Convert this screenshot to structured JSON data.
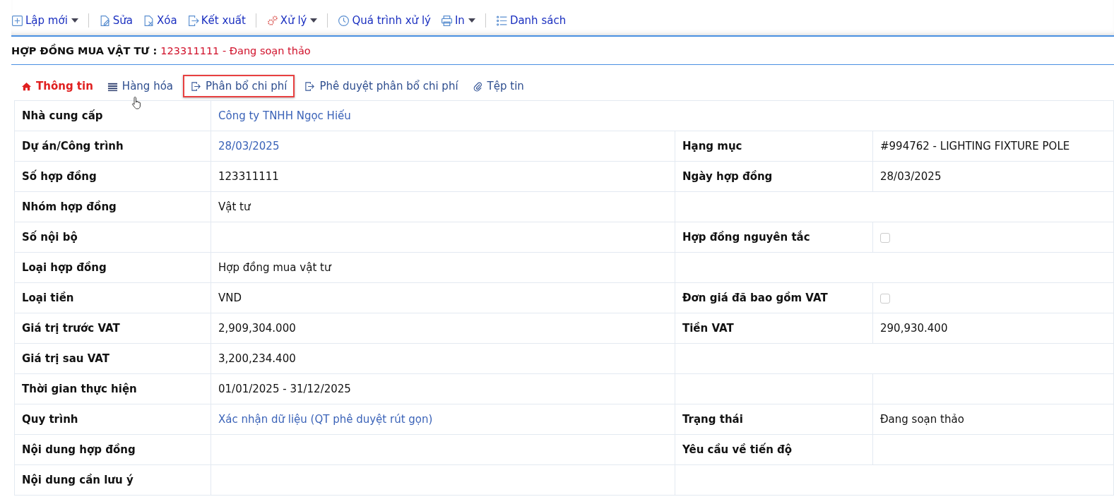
{
  "toolbar_groups": [
    [
      {
        "kind": "plus",
        "label": "Lập mới",
        "dropdown": true
      }
    ],
    [
      {
        "kind": "edit",
        "label": "Sửa",
        "dropdown": false
      },
      {
        "kind": "delete",
        "label": "Xóa",
        "dropdown": false
      },
      {
        "kind": "export",
        "label": "Kết xuất",
        "dropdown": false
      }
    ],
    [
      {
        "kind": "gears",
        "label": "Xử lý",
        "dropdown": true
      }
    ],
    [
      {
        "kind": "clock",
        "label": "Quá trình xử lý",
        "dropdown": false
      },
      {
        "kind": "print",
        "label": "In",
        "dropdown": true
      }
    ],
    [
      {
        "kind": "list",
        "label": "Danh sách",
        "dropdown": false
      }
    ]
  ],
  "header": {
    "title": "HỢP ĐỒNG MUA VẬT TƯ :",
    "status": "123311111 - Đang soạn thảo"
  },
  "tabs": [
    {
      "kind": "home",
      "label": "Thông tin",
      "selected": true,
      "highlighted": false
    },
    {
      "kind": "lines",
      "label": "Hàng hóa",
      "selected": false,
      "highlighted": false
    },
    {
      "kind": "export",
      "label": "Phân bổ chi phí",
      "selected": false,
      "highlighted": true
    },
    {
      "kind": "export",
      "label": "Phê duyệt phân bổ chi phí",
      "selected": false,
      "highlighted": false
    },
    {
      "kind": "clip",
      "label": "Tệp tin",
      "selected": false,
      "highlighted": false
    }
  ],
  "rows": [
    {
      "label": "Nhà cung cấp",
      "value": "Công ty TNHH Ngọc Hiếu",
      "link": true
    },
    {
      "label": "Dự án/Công trình",
      "value": "28/03/2025",
      "link": true,
      "right": {
        "kind": "text",
        "label": "Hạng mục",
        "value": "#994762 - LIGHTING FIXTURE POLE"
      }
    },
    {
      "label": "Số hợp đồng",
      "value": "123311111",
      "link": false,
      "right": {
        "kind": "text",
        "label": "Ngày hợp đồng",
        "value": "28/03/2025"
      }
    },
    {
      "label": "Nhóm hợp đồng",
      "value": "Vật tư",
      "link": false,
      "right": {
        "kind": "blank"
      }
    },
    {
      "label": "Số nội bộ",
      "right": {
        "kind": "checkbox",
        "label": "Hợp đồng nguyên tắc",
        "checked": false
      }
    },
    {
      "label": "Loại hợp đồng",
      "value": "Hợp đồng mua vật tư",
      "link": false,
      "right": {
        "kind": "blank"
      }
    },
    {
      "label": "Loại tiền",
      "value": "VND",
      "link": false,
      "right": {
        "kind": "checkbox",
        "label": "Đơn giá đã bao gồm VAT",
        "checked": false
      }
    },
    {
      "label": "Giá trị trước VAT",
      "value": "2,909,304.000",
      "link": false,
      "right": {
        "kind": "text",
        "label": "Tiền VAT",
        "value": "290,930.400"
      }
    },
    {
      "label": "Giá trị sau VAT",
      "value": "3,200,234.400",
      "link": false,
      "right": {
        "kind": "blank"
      }
    },
    {
      "label": "Thời gian thực hiện",
      "value": "01/01/2025 - 31/12/2025",
      "link": false,
      "right": {
        "kind": "split"
      }
    },
    {
      "label": "Quy trình",
      "value": "Xác nhận dữ liệu (QT phê duyệt rút gọn)",
      "link": true,
      "right": {
        "kind": "text",
        "label": "Trạng thái",
        "value": "Đang soạn thảo"
      }
    },
    {
      "label": "Nội dung hợp đồng",
      "right": {
        "kind": "text",
        "label": "Yêu cầu về tiến độ"
      }
    },
    {
      "label": "Nội dung cần lưu ý",
      "right": {
        "kind": "blank"
      }
    }
  ]
}
